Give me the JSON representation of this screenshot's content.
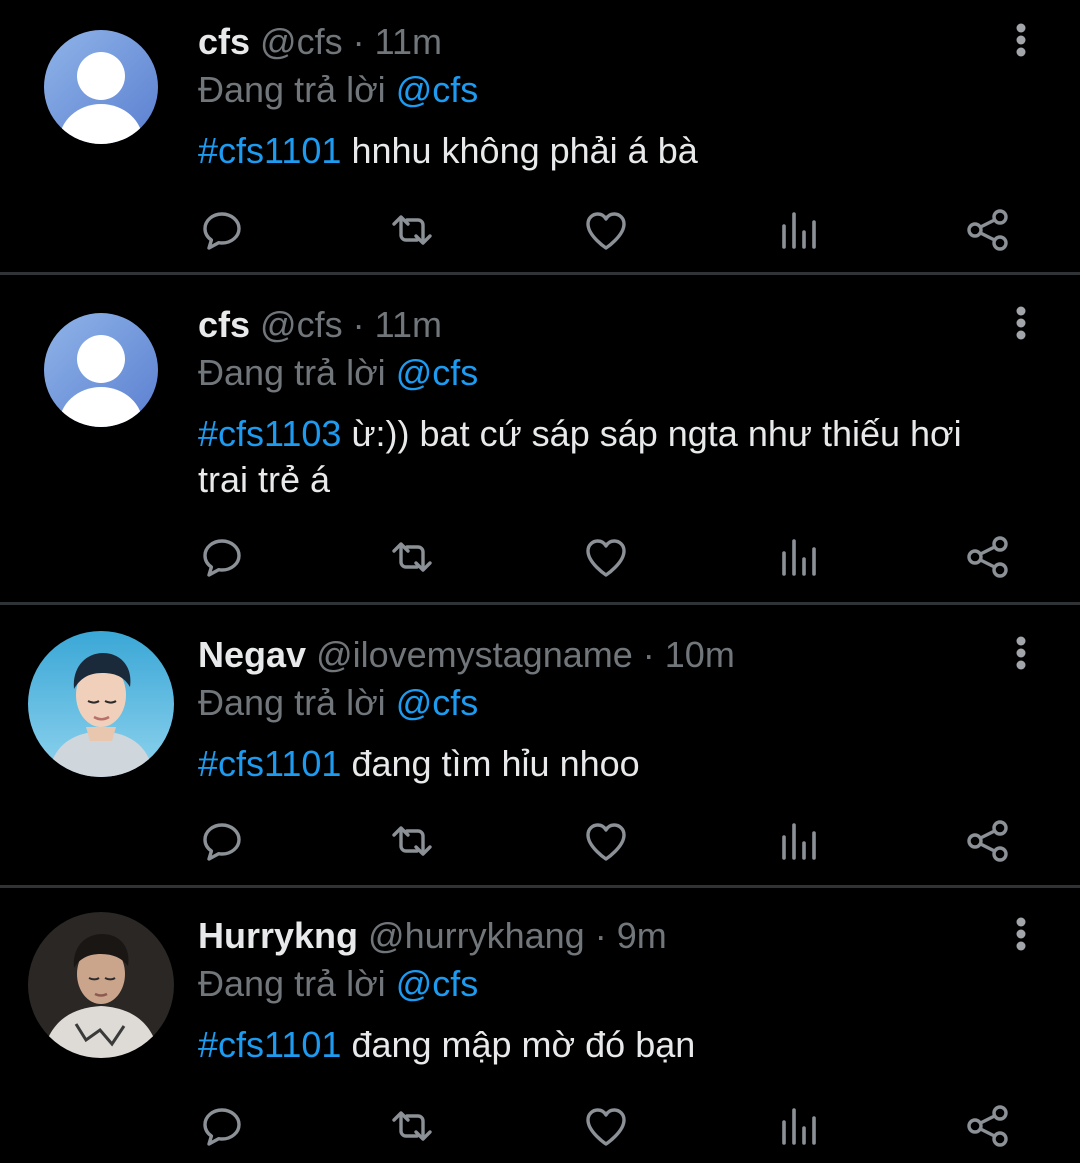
{
  "reply_prefix": "Đang trả lời",
  "colors": {
    "background": "#000000",
    "text": "#e7e9ea",
    "muted": "#71767b",
    "accent": "#1d9bf0",
    "divider": "#2f3336"
  },
  "action_icons": [
    "reply-icon",
    "retweet-icon",
    "like-icon",
    "views-icon",
    "share-icon"
  ],
  "tweets": [
    {
      "name": "cfs",
      "handle": "@cfs",
      "time": "11m",
      "reply_to": "@cfs",
      "hashtag": "#cfs1101",
      "text": " hnhu không phải á bà"
    },
    {
      "name": "cfs",
      "handle": "@cfs",
      "time": "11m",
      "reply_to": "@cfs",
      "hashtag": "#cfs1103",
      "text": " ừ:)) bat cứ sáp sáp ngta như thiếu hơi trai trẻ á"
    },
    {
      "name": "Negav",
      "handle": "@ilovemystagname",
      "time": "10m",
      "reply_to": "@cfs",
      "hashtag": "#cfs1101",
      "text": " đang tìm hỉu nhoo"
    },
    {
      "name": "Hurrykng",
      "handle": "@hurrykhang",
      "time": "9m",
      "reply_to": "@cfs",
      "hashtag": "#cfs1101",
      "text": " đang mập mờ đó bạn"
    }
  ]
}
